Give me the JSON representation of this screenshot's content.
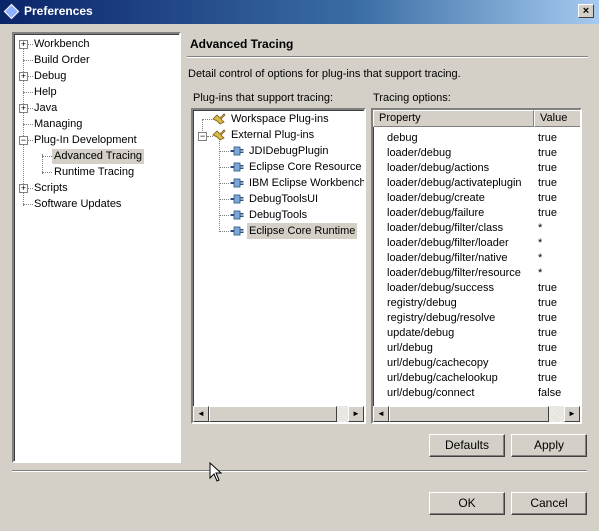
{
  "window": {
    "title": "Preferences",
    "close_glyph": "×"
  },
  "nav_tree": {
    "items": [
      {
        "label": "Workbench",
        "expandable": true
      },
      {
        "label": "Build Order",
        "expandable": false
      },
      {
        "label": "Debug",
        "expandable": true
      },
      {
        "label": "Help",
        "expandable": false
      },
      {
        "label": "Java",
        "expandable": true
      },
      {
        "label": "Managing",
        "expandable": false
      },
      {
        "label": "Plug-In Development",
        "expandable": true,
        "expanded": true
      },
      {
        "label": "Advanced Tracing",
        "child": true,
        "selected": true
      },
      {
        "label": "Runtime Tracing",
        "child": true
      },
      {
        "label": "Scripts",
        "expandable": true
      },
      {
        "label": "Software Updates",
        "expandable": false
      }
    ]
  },
  "page": {
    "title": "Advanced Tracing",
    "description": "Detail control of options for plug-ins that support tracing.",
    "plugins_label": "Plug-ins that support tracing:",
    "options_label": "Tracing options:"
  },
  "plugin_tree": {
    "groups": [
      {
        "label": "Workspace Plug-ins"
      },
      {
        "label": "External Plug-ins"
      }
    ],
    "children": [
      "JDIDebugPlugin",
      "Eclipse Core Resource",
      "IBM Eclipse Workbench",
      "DebugToolsUI",
      "DebugTools",
      "Eclipse Core Runtime"
    ],
    "selected_child": "Eclipse Core Runtime"
  },
  "tracing_table": {
    "columns": [
      "Property",
      "Value"
    ],
    "rows": [
      [
        "debug",
        "true"
      ],
      [
        "loader/debug",
        "true"
      ],
      [
        "loader/debug/actions",
        "true"
      ],
      [
        "loader/debug/activateplugin",
        "true"
      ],
      [
        "loader/debug/create",
        "true"
      ],
      [
        "loader/debug/failure",
        "true"
      ],
      [
        "loader/debug/filter/class",
        "*"
      ],
      [
        "loader/debug/filter/loader",
        "*"
      ],
      [
        "loader/debug/filter/native",
        "*"
      ],
      [
        "loader/debug/filter/resource",
        "*"
      ],
      [
        "loader/debug/success",
        "true"
      ],
      [
        "registry/debug",
        "true"
      ],
      [
        "registry/debug/resolve",
        "true"
      ],
      [
        "update/debug",
        "true"
      ],
      [
        "url/debug",
        "true"
      ],
      [
        "url/debug/cachecopy",
        "true"
      ],
      [
        "url/debug/cachelookup",
        "true"
      ],
      [
        "url/debug/connect",
        "false"
      ]
    ]
  },
  "buttons": {
    "defaults": "Defaults",
    "apply": "Apply",
    "ok": "OK",
    "cancel": "Cancel"
  },
  "scroll": {
    "left_arrow": "◄",
    "right_arrow": "►"
  },
  "colors": {
    "titlebar_start": "#0a246a",
    "titlebar_end": "#a6caf0",
    "face": "#d4d0c8"
  },
  "icons": {
    "plugin_group": "plugin-folder-icon",
    "plugin": "plugin-icon",
    "expand": "plus-box-icon",
    "collapse": "minus-box-icon"
  }
}
